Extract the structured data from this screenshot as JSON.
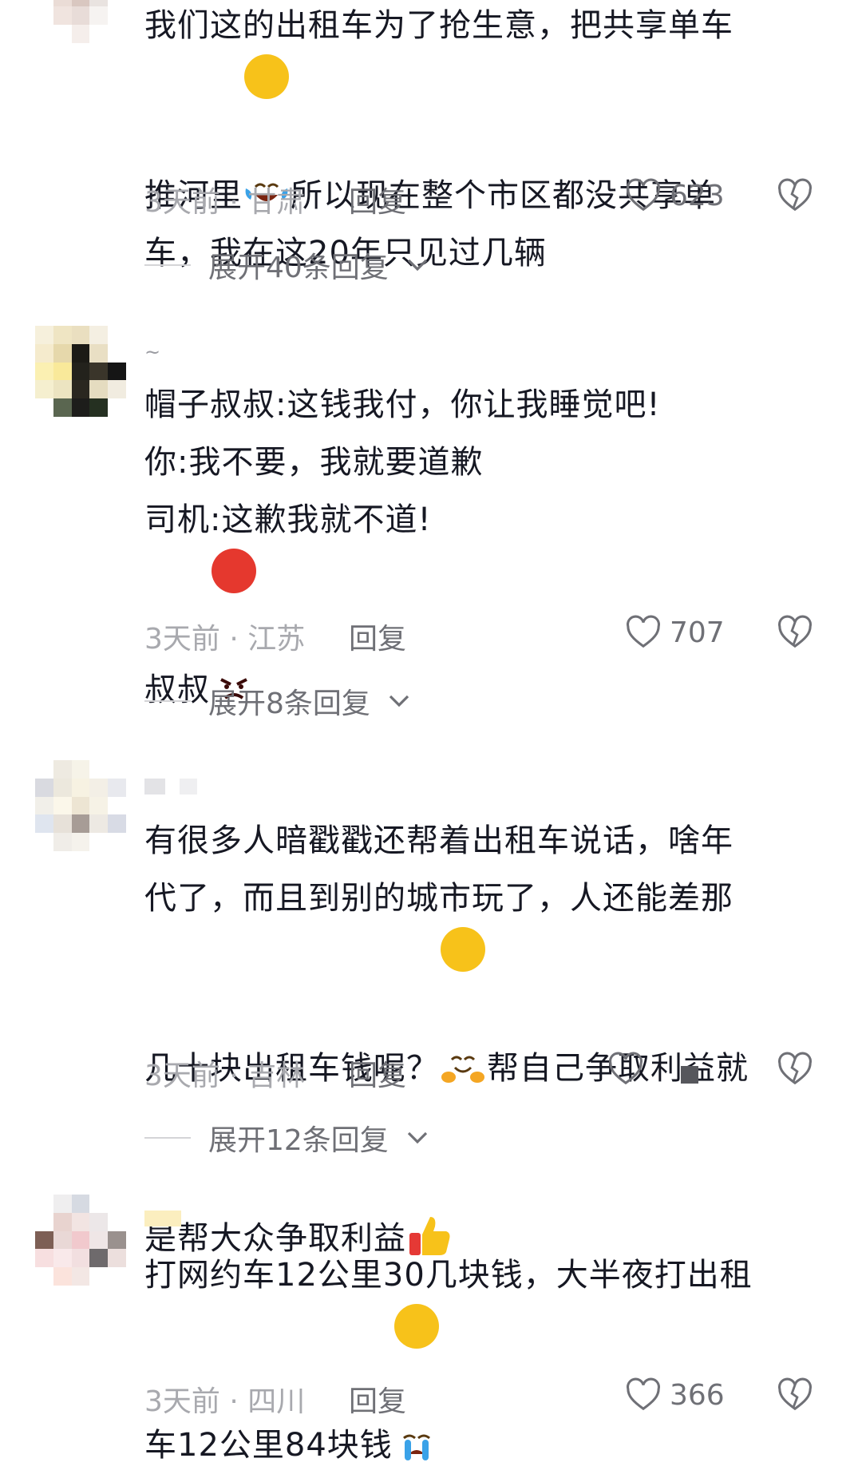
{
  "comments": [
    {
      "nickname": "",
      "lines": [
        "我们这的出租车为了抢生意，把共享单车",
        "推河里",
        "所以现在整个市区都没共享单",
        "车，我在这20年只见过几辆"
      ],
      "emoji1": "laughing-tears-emoji",
      "time_location": "3天前 · 甘肃",
      "reply_label": "回复",
      "likes": "623",
      "expand_label": "展开40条回复"
    },
    {
      "nickname": "~",
      "lines": [
        "帽子叔叔:这钱我付，你让我睡觉吧!",
        "你:我不要，我就要道歉",
        "司机:这歉我就不道!",
        "叔叔"
      ],
      "emoji1": "angry-face-emoji",
      "time_location": "3天前 · 江苏",
      "reply_label": "回复",
      "likes": "707",
      "expand_label": "展开8条回复"
    },
    {
      "nickname": "",
      "lines": [
        "有很多人暗戳戳还帮着出租车说话，啥年",
        "代了，而且到别的城市玩了，人还能差那",
        "几十块出租车钱呢？",
        "帮自己争取利益就",
        "是帮大众争取利益"
      ],
      "emoji1": "smiling-hug-emoji",
      "emoji2": "thumbs-up-emoji",
      "time_location": "3天前 · 吉林",
      "reply_label": "回复",
      "likes": "",
      "expand_label": "展开12条回复"
    },
    {
      "nickname": "",
      "lines": [
        "打网约车12公里30几块钱，大半夜打出租",
        "车12公里84块钱"
      ],
      "emoji1": "crying-face-emoji",
      "time_location": "3天前 · 四川",
      "reply_label": "回复",
      "likes": "366"
    }
  ],
  "colors": {
    "text": "#161823",
    "meta": "#a8a9ae",
    "action": "#6f7076",
    "emoji_yellow": "#f7c21a",
    "emoji_red": "#e5382e"
  },
  "icons": [
    "heart-outline-icon",
    "broken-heart-icon",
    "chevron-down-icon"
  ]
}
